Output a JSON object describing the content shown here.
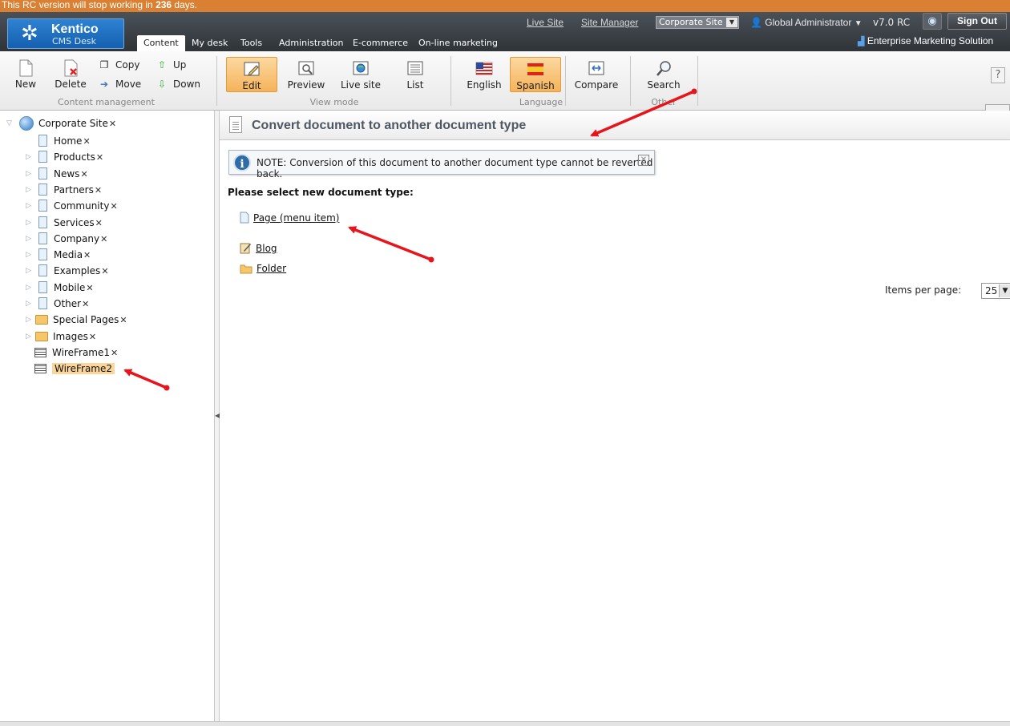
{
  "banner": {
    "rc_notice_prefix": "This RC version will stop working in ",
    "rc_days": "236",
    "rc_notice_suffix": " days."
  },
  "header": {
    "logo_name": "Kentico",
    "logo_sub": "CMS Desk",
    "links": {
      "live_site": "Live Site",
      "site_manager": "Site Manager"
    },
    "site_select": "Corporate Site",
    "user": "Global Administrator",
    "version": "v7.0 RC",
    "sign_out": "Sign Out",
    "ems": "Enterprise Marketing Solution",
    "tabs": [
      "Content",
      "My desk",
      "Tools",
      "Administration",
      "E-commerce",
      "On-line marketing"
    ],
    "active_tab": "Content"
  },
  "toolbar": {
    "content_management": {
      "new": "New",
      "delete": "Delete",
      "copy": "Copy",
      "move": "Move",
      "up": "Up",
      "down": "Down",
      "label": "Content management"
    },
    "view_mode": {
      "edit": "Edit",
      "preview": "Preview",
      "live_site": "Live site",
      "list": "List",
      "label": "View mode"
    },
    "language": {
      "english": "English",
      "spanish": "Spanish",
      "compare": "Compare",
      "label": "Language"
    },
    "other": {
      "search": "Search",
      "label": "Other"
    },
    "help": "?"
  },
  "tree": {
    "root": "Corporate Site",
    "nodes": [
      "Home",
      "Products",
      "News",
      "Partners",
      "Community",
      "Services",
      "Company",
      "Media",
      "Examples",
      "Mobile",
      "Other",
      "Special Pages",
      "Images",
      "WireFrame1",
      "WireFrame2"
    ],
    "selected": "WireFrame2"
  },
  "content": {
    "title": "Convert document to another document type",
    "note": "NOTE: Conversion of this document to another document type cannot be reverted back.",
    "select_label": "Please select new document type:",
    "types": [
      "Page (menu item)",
      "Blog",
      "Folder"
    ],
    "items_per_page_label": "Items per page:",
    "items_per_page": "25"
  },
  "colors": {
    "rc_banner": "#d98032",
    "header": "#3a3f44",
    "selected": "#f5b35a",
    "annotation_arrow": "#e8141c"
  },
  "icons": {
    "logo": "snowflake-icon",
    "globe": "globe-icon",
    "user": "user-icon",
    "info": "info-icon",
    "search": "magnifier-icon"
  }
}
